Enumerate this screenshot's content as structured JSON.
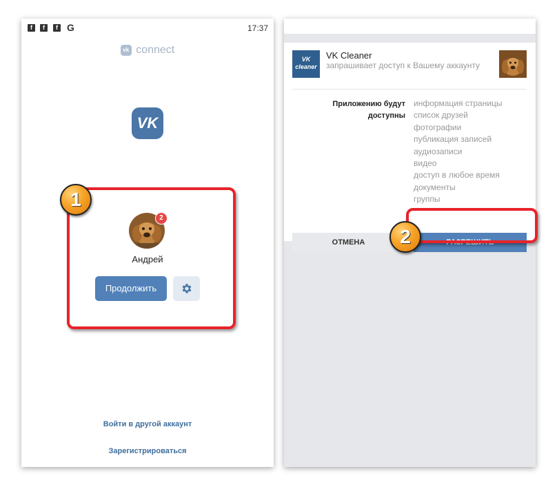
{
  "status_bar": {
    "time": "17:37",
    "icons": [
      "f",
      "f",
      "f",
      "G"
    ]
  },
  "left": {
    "logo_text": "connect",
    "logo_badge": "vk",
    "vk_logo": "VK",
    "avatar_badge_count": "2",
    "user_name": "Андрей",
    "continue_button": "Продолжить",
    "settings_icon": "gear-icon",
    "login_other_link": "Войти в другой аккаунт",
    "register_link": "Зарегистрироваться"
  },
  "right": {
    "app_name": "VK Cleaner",
    "app_icon_text": "VK cleaner",
    "request_text": "запрашивает доступ к Вашему аккаунту",
    "permissions_label": "Приложению будут доступны",
    "permissions": [
      "информация страницы",
      "список друзей",
      "фотографии",
      "публикация записей",
      "аудиозаписи",
      "видео",
      "доступ в любое время",
      "документы",
      "группы"
    ],
    "cancel_button": "ОТМЕНА",
    "allow_button": "РАЗРЕШИТЬ"
  },
  "annotations": {
    "step1": "1",
    "step2": "2"
  },
  "colors": {
    "vk_blue": "#5181b8",
    "highlight_red": "#e8232b"
  }
}
